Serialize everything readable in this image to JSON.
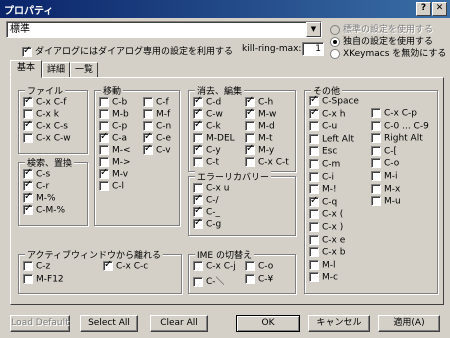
{
  "window": {
    "title": "プロパティ"
  },
  "profile_select": {
    "value": "標準"
  },
  "radios": [
    {
      "label": "標準の設定を使用する",
      "selected": false,
      "enabled": false
    },
    {
      "label": "独自の設定を使用する",
      "selected": true,
      "enabled": true
    },
    {
      "label": "XKeymacs を無効にする",
      "selected": false,
      "enabled": true
    }
  ],
  "dialog_specific": {
    "label": "ダイアログにはダイアログ専用の設定を利用する",
    "checked": true
  },
  "kill_ring": {
    "label": "kill-ring-max:",
    "value": "1"
  },
  "tabs": [
    "基本",
    "詳細",
    "一覧"
  ],
  "groups": {
    "file": {
      "title": "ファイル",
      "items": [
        {
          "label": "C-x C-f",
          "checked": true
        },
        {
          "label": "C-x k",
          "checked": false
        },
        {
          "label": "C-x C-s",
          "checked": true
        },
        {
          "label": "C-x C-w",
          "checked": false
        }
      ]
    },
    "search": {
      "title": "検索、置換",
      "items": [
        {
          "label": "C-s",
          "checked": true
        },
        {
          "label": "C-r",
          "checked": true
        },
        {
          "label": "M-%",
          "checked": true
        },
        {
          "label": "C-M-%",
          "checked": true
        }
      ]
    },
    "move": {
      "title": "移動",
      "col1": [
        {
          "label": "C-b",
          "checked": false
        },
        {
          "label": "M-b",
          "checked": false
        },
        {
          "label": "C-p",
          "checked": false
        },
        {
          "label": "C-a",
          "checked": true
        },
        {
          "label": "M-<",
          "checked": false
        },
        {
          "label": "M->",
          "checked": false
        },
        {
          "label": "M-v",
          "checked": true
        },
        {
          "label": "C-l",
          "checked": false
        }
      ],
      "col2": [
        {
          "label": "C-f",
          "checked": false
        },
        {
          "label": "M-f",
          "checked": false
        },
        {
          "label": "C-n",
          "checked": false
        },
        {
          "label": "C-e",
          "checked": true
        },
        {
          "label": "C-v",
          "checked": true
        }
      ]
    },
    "edit": {
      "title": "消去、編集",
      "col1": [
        {
          "label": "C-d",
          "checked": true
        },
        {
          "label": "C-w",
          "checked": true
        },
        {
          "label": "C-k",
          "checked": true
        },
        {
          "label": "M-DEL",
          "checked": false
        },
        {
          "label": "C-y",
          "checked": true
        },
        {
          "label": "C-t",
          "checked": false
        }
      ],
      "col2": [
        {
          "label": "C-h",
          "checked": true
        },
        {
          "label": "M-w",
          "checked": true
        },
        {
          "label": "M-d",
          "checked": false
        },
        {
          "label": "M-t",
          "checked": false
        },
        {
          "label": "M-y",
          "checked": true
        },
        {
          "label": "C-x C-t",
          "checked": false
        }
      ]
    },
    "error": {
      "title": "エラーリカバリー",
      "items": [
        {
          "label": "C-x u",
          "checked": false
        },
        {
          "label": "C-/",
          "checked": true
        },
        {
          "label": "C-_",
          "checked": true
        },
        {
          "label": "C-g",
          "checked": true
        }
      ]
    },
    "window": {
      "title": "アクティブウィンドウから離れる",
      "col1": [
        {
          "label": "C-z",
          "checked": false
        },
        {
          "label": "M-F12",
          "checked": false
        }
      ],
      "col2": [
        {
          "label": "C-x C-c",
          "checked": true
        }
      ]
    },
    "ime": {
      "title": "IME の切替え",
      "col1": [
        {
          "label": "C-x C-j",
          "checked": false
        },
        {
          "label": "C-＼",
          "checked": false
        }
      ],
      "col2": [
        {
          "label": "C-o",
          "checked": false
        },
        {
          "label": "C-¥",
          "checked": false
        }
      ]
    },
    "other": {
      "title": "その他",
      "col1": [
        {
          "label": "C-Space",
          "checked": true
        },
        {
          "label": "C-x h",
          "checked": true
        },
        {
          "label": "C-u",
          "checked": false
        },
        {
          "label": "Left Alt",
          "checked": false
        },
        {
          "label": "Esc",
          "checked": false
        },
        {
          "label": "C-m",
          "checked": false
        },
        {
          "label": "C-i",
          "checked": false
        },
        {
          "label": "M-!",
          "checked": false
        },
        {
          "label": "C-q",
          "checked": true
        },
        {
          "label": "C-x (",
          "checked": false
        },
        {
          "label": "C-x )",
          "checked": false
        },
        {
          "label": "C-x e",
          "checked": false
        },
        {
          "label": "C-x b",
          "checked": false
        },
        {
          "label": "M-l",
          "checked": false
        },
        {
          "label": "M-c",
          "checked": false
        }
      ],
      "col2": [
        {
          "label": "C-x C-p",
          "checked": false
        },
        {
          "label": "C-0 ... C-9",
          "checked": false
        },
        {
          "label": "Right Alt",
          "checked": false
        },
        {
          "label": "C-[",
          "checked": false
        },
        {
          "label": "C-o",
          "checked": false
        },
        {
          "label": "M-i",
          "checked": false
        },
        {
          "label": "M-x",
          "checked": false
        },
        {
          "label": "M-u",
          "checked": false
        }
      ]
    }
  },
  "buttons": {
    "load_default": "Load Default",
    "select_all": "Select All",
    "clear_all": "Clear All",
    "ok": "OK",
    "cancel": "キャンセル",
    "apply": "適用(A)"
  }
}
